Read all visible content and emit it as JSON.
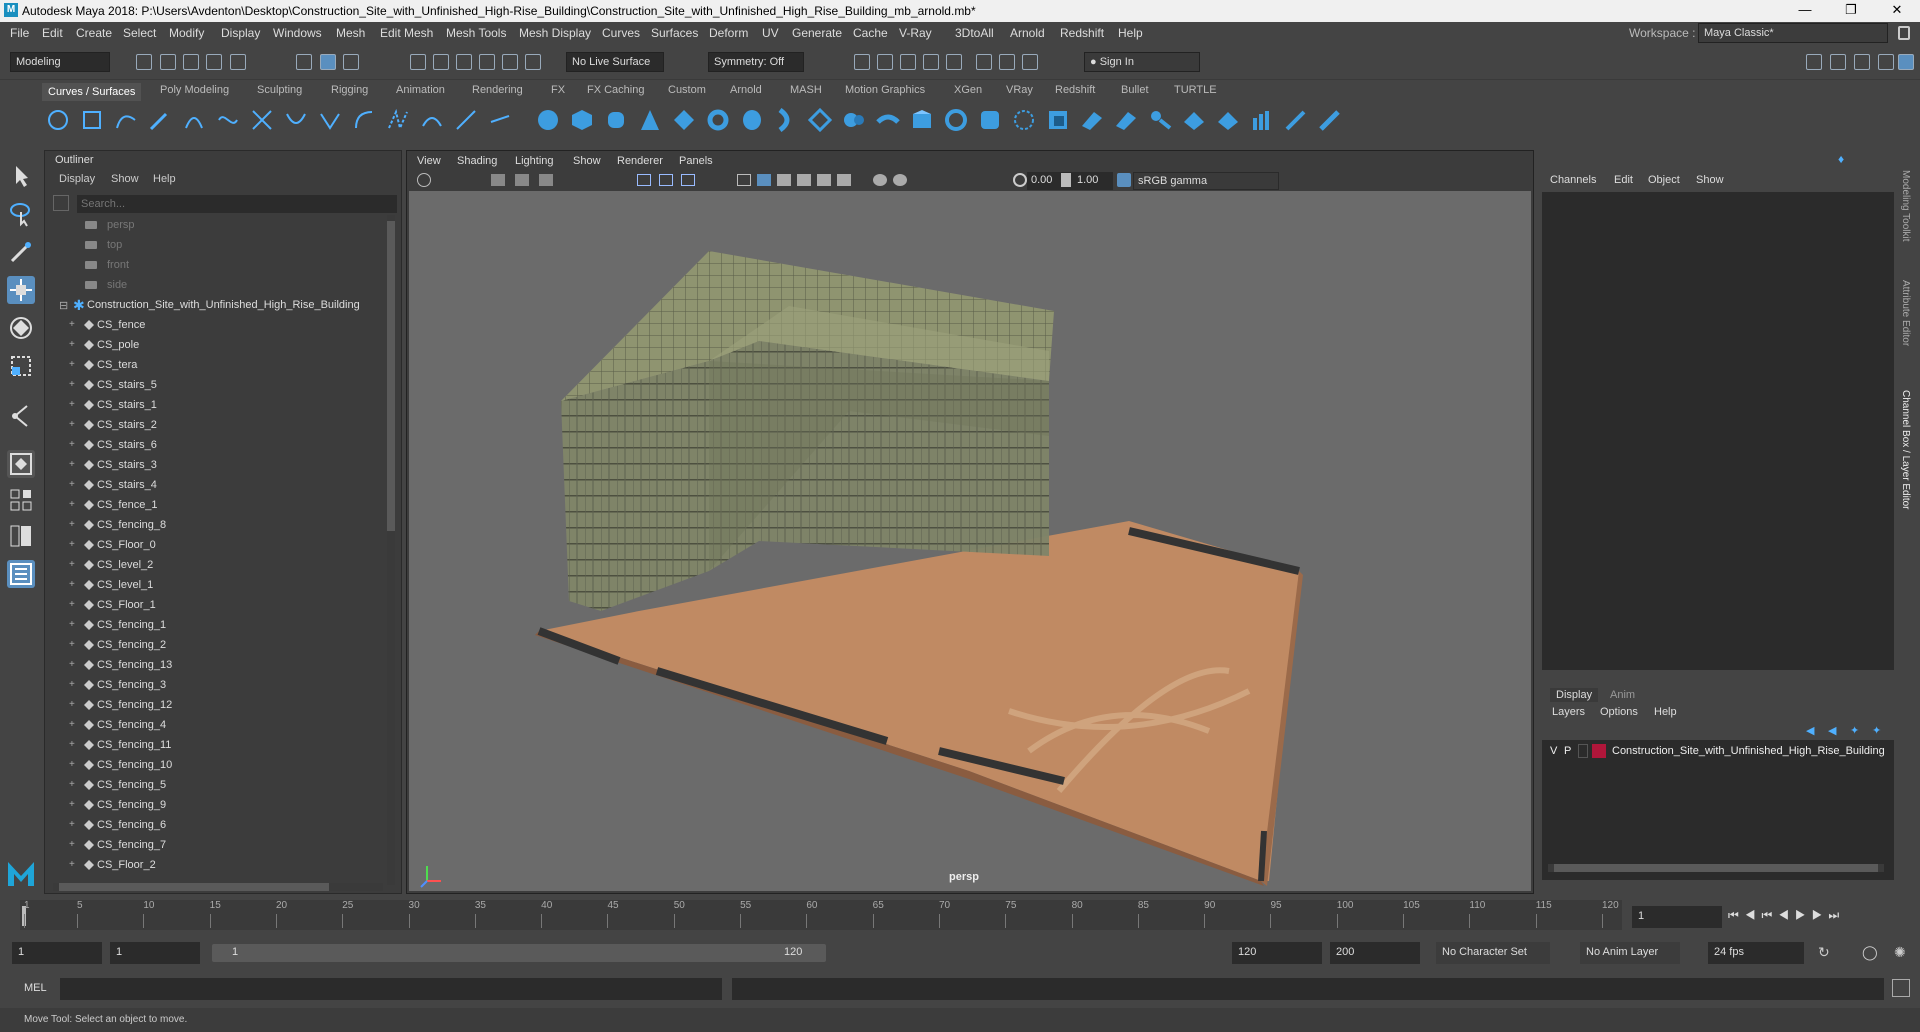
{
  "window": {
    "title": "Autodesk Maya 2018: P:\\Users\\Avdenton\\Desktop\\Construction_Site_with_Unfinished_High-Rise_Building\\Construction_Site_with_Unfinished_High_Rise_Building_mb_arnold.mb*",
    "logo": "M",
    "workspace_label": "Workspace :",
    "workspace_value": "Maya Classic*"
  },
  "menubar": [
    "File",
    "Edit",
    "Create",
    "Select",
    "Modify",
    "Display",
    "Windows",
    "Mesh",
    "Edit Mesh",
    "Mesh Tools",
    "Mesh Display",
    "Curves",
    "Surfaces",
    "Deform",
    "UV",
    "Generate",
    "Cache",
    "V-Ray",
    "3DtoAll",
    "Arnold",
    "Redshift",
    "Help"
  ],
  "toolbar": {
    "mode": "Modeling",
    "live_surface": "No Live Surface",
    "symmetry": "Symmetry: Off",
    "sign_in": "Sign In"
  },
  "shelf_tabs": [
    "Curves / Surfaces",
    "Poly Modeling",
    "Sculpting",
    "Rigging",
    "Animation",
    "Rendering",
    "FX",
    "FX Caching",
    "Custom",
    "Arnold",
    "MASH",
    "Motion Graphics",
    "XGen",
    "VRay",
    "Redshift",
    "Bullet",
    "TURTLE"
  ],
  "outliner": {
    "title": "Outliner",
    "menu": [
      "Display",
      "Show",
      "Help"
    ],
    "search_placeholder": "Search...",
    "cameras": [
      "persp",
      "top",
      "front",
      "side"
    ],
    "root": "Construction_Site_with_Unfinished_High_Rise_Building",
    "items": [
      "CS_fence",
      "CS_pole",
      "CS_tera",
      "CS_stairs_5",
      "CS_stairs_1",
      "CS_stairs_2",
      "CS_stairs_6",
      "CS_stairs_3",
      "CS_stairs_4",
      "CS_fence_1",
      "CS_fencing_8",
      "CS_Floor_0",
      "CS_level_2",
      "CS_level_1",
      "CS_Floor_1",
      "CS_fencing_1",
      "CS_fencing_2",
      "CS_fencing_13",
      "CS_fencing_3",
      "CS_fencing_12",
      "CS_fencing_4",
      "CS_fencing_11",
      "CS_fencing_10",
      "CS_fencing_5",
      "CS_fencing_9",
      "CS_fencing_6",
      "CS_fencing_7",
      "CS_Floor_2"
    ]
  },
  "viewport": {
    "menu": [
      "View",
      "Shading",
      "Lighting",
      "Show",
      "Renderer",
      "Panels"
    ],
    "exposure": "0.00",
    "gamma": "1.00",
    "color_space": "sRGB gamma",
    "camera_label": "persp"
  },
  "channelbox": {
    "menu": [
      "Channels",
      "Edit",
      "Object",
      "Show"
    ],
    "side_tabs": [
      "Modeling Toolkit",
      "Attribute Editor",
      "Channel Box / Layer Editor"
    ],
    "layer_tabs": [
      "Display",
      "Anim"
    ],
    "layer_menu": [
      "Layers",
      "Options",
      "Help"
    ],
    "layer_v": "V",
    "layer_p": "P",
    "layer_name": "Construction_Site_with_Unfinished_High_Rise_Building",
    "layer_color": "#b0163a"
  },
  "timeline": {
    "ticks": [
      "1",
      "5",
      "10",
      "15",
      "20",
      "25",
      "30",
      "35",
      "40",
      "45",
      "50",
      "55",
      "60",
      "65",
      "70",
      "75",
      "80",
      "85",
      "90",
      "95",
      "100",
      "105",
      "110",
      "115",
      "120"
    ],
    "current_frame": "1"
  },
  "range": {
    "start": "1",
    "start2": "1",
    "slider_start": "1",
    "slider_end": "120",
    "end": "120",
    "end2": "200",
    "character_set": "No Character Set",
    "anim_layer": "No Anim Layer",
    "fps": "24 fps"
  },
  "command": {
    "lang": "MEL"
  },
  "help_line": "Move Tool: Select an object to move."
}
